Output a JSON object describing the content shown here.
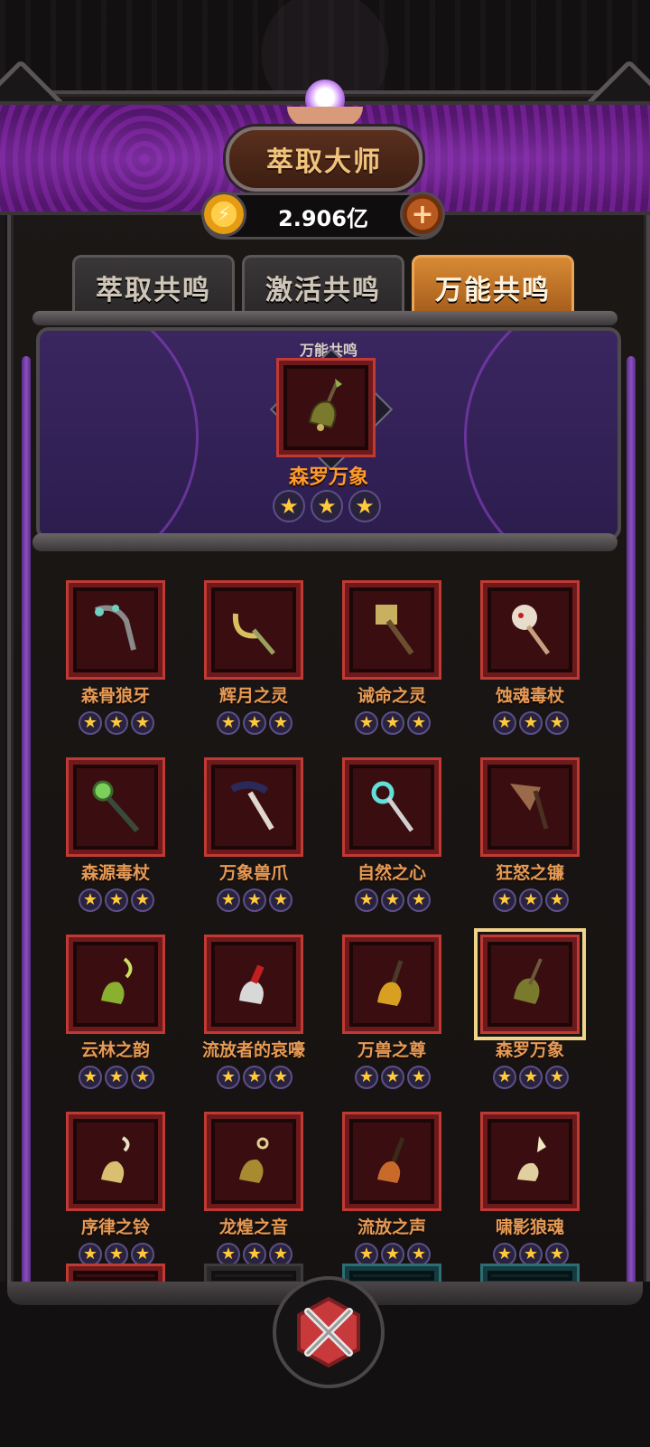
{
  "header": {
    "title": "萃取大师",
    "currency_value": "2.906亿",
    "currency_icon": "gold-coin-icon",
    "add_icon": "plus-icon"
  },
  "tabs": [
    {
      "label": "萃取共鸣",
      "active": false
    },
    {
      "label": "激活共鸣",
      "active": false
    },
    {
      "label": "万能共鸣",
      "active": true
    }
  ],
  "featured": {
    "label": "万能共鸣",
    "item_name": "森罗万象",
    "stars": 3
  },
  "items": [
    {
      "name": "森骨狼牙",
      "stars": 3
    },
    {
      "name": "辉月之灵",
      "stars": 3
    },
    {
      "name": "诫命之灵",
      "stars": 3
    },
    {
      "name": "蚀魂毒杖",
      "stars": 3
    },
    {
      "name": "森源毒杖",
      "stars": 3
    },
    {
      "name": "万象兽爪",
      "stars": 3
    },
    {
      "name": "自然之心",
      "stars": 3
    },
    {
      "name": "狂怒之镰",
      "stars": 3
    },
    {
      "name": "云林之韵",
      "stars": 3
    },
    {
      "name": "流放者的哀嚎",
      "stars": 3
    },
    {
      "name": "万兽之尊",
      "stars": 3
    },
    {
      "name": "森罗万象",
      "stars": 3,
      "selected": true
    },
    {
      "name": "序律之铃",
      "stars": 3
    },
    {
      "name": "龙煌之音",
      "stars": 3
    },
    {
      "name": "流放之声",
      "stars": 3
    },
    {
      "name": "啸影狼魂",
      "stars": 3
    }
  ],
  "star_glyph": "★",
  "colors": {
    "accent_orange": "#ff9a2e",
    "item_name": "#e69a55",
    "banner_purple": "#5d1a7a",
    "active_tab": "#d88a34",
    "slot_red": "#c03a33"
  }
}
